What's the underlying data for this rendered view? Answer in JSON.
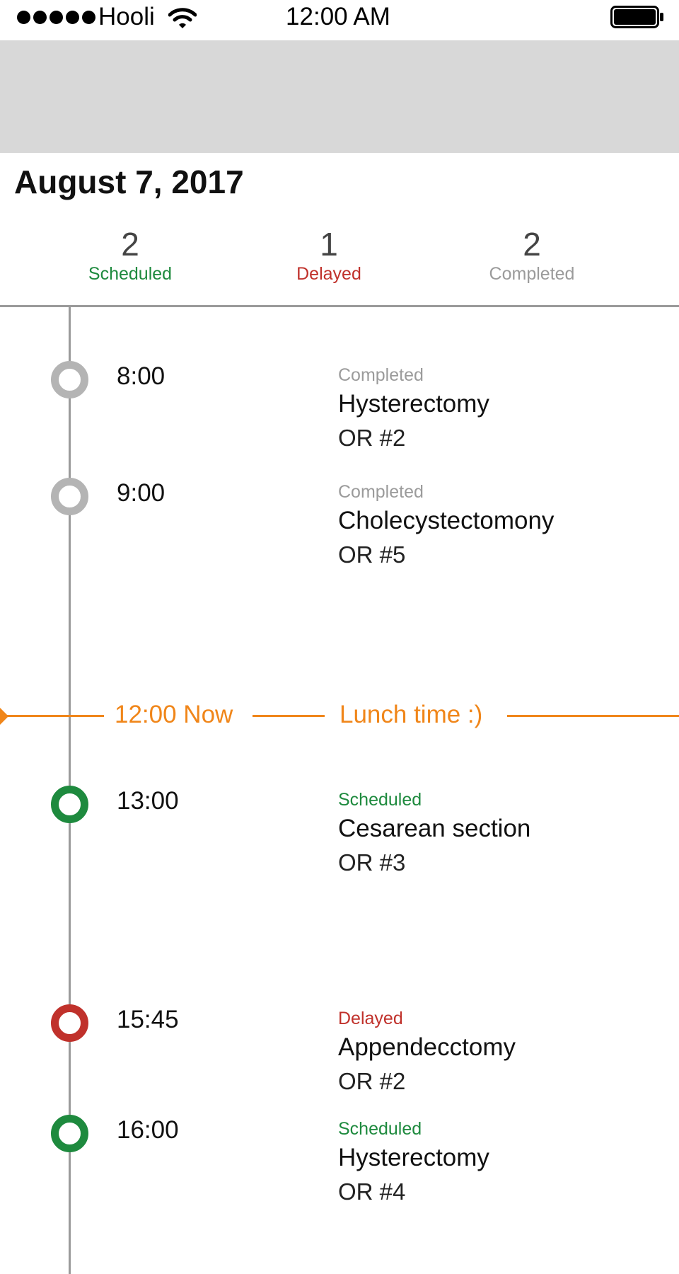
{
  "status_bar": {
    "carrier": "Hooli",
    "time": "12:00 AM",
    "signal_icon": "signal-dots-icon",
    "wifi_icon": "wifi-icon",
    "battery_icon": "battery-icon"
  },
  "page": {
    "title": "August 7, 2017"
  },
  "summary": [
    {
      "count": "2",
      "label": "Scheduled",
      "color": "#1e8a3e"
    },
    {
      "count": "1",
      "label": "Delayed",
      "color": "#c0312b"
    },
    {
      "count": "2",
      "label": "Completed",
      "color": "#9b9b9b"
    }
  ],
  "now_line": {
    "time_label": "12:00 Now",
    "note": "Lunch time :)",
    "color": "#f0861a"
  },
  "events": [
    {
      "time": "8:00",
      "status": "Completed",
      "procedure": "Hysterectomy",
      "room": "OR #2",
      "color": "#b4b4b4",
      "status_color": "#9b9b9b"
    },
    {
      "time": "9:00",
      "status": "Completed",
      "procedure": "Cholecystectomony",
      "room": "OR #5",
      "color": "#b4b4b4",
      "status_color": "#9b9b9b"
    },
    {
      "time": "13:00",
      "status": "Scheduled",
      "procedure": "Cesarean section",
      "room": "OR #3",
      "color": "#1e8a3e",
      "status_color": "#1e8a3e"
    },
    {
      "time": "15:45",
      "status": "Delayed",
      "procedure": "Appendecctomy",
      "room": "OR #2",
      "color": "#c0312b",
      "status_color": "#c0312b"
    },
    {
      "time": "16:00",
      "status": "Scheduled",
      "procedure": "Hysterectomy",
      "room": "OR #4",
      "color": "#1e8a3e",
      "status_color": "#1e8a3e"
    }
  ]
}
